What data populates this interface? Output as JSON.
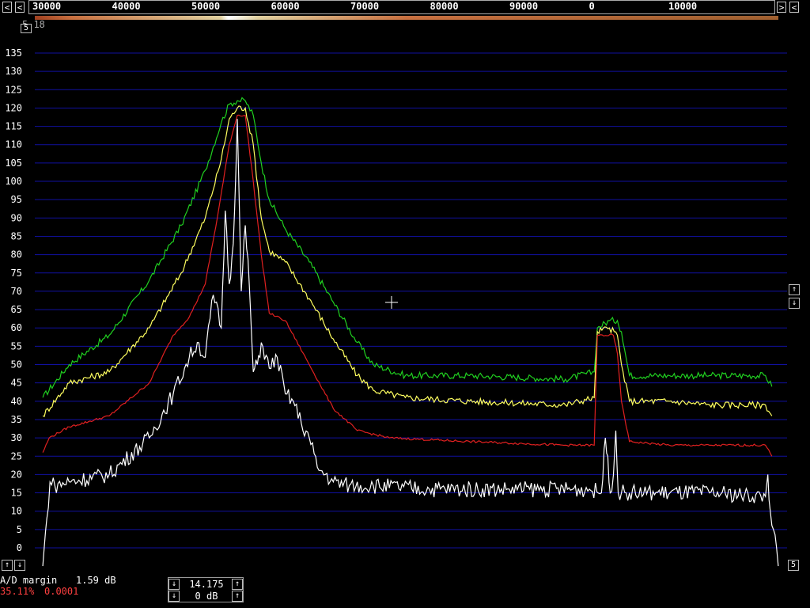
{
  "top_bar": {
    "left_arrow": "<",
    "right_arrow": ">",
    "right_arrow2": "<",
    "freq_labels": [
      "30000",
      "40000",
      "50000",
      "60000",
      "70000",
      "80000",
      "90000",
      "0",
      "10000"
    ]
  },
  "status": {
    "top_left_text": "5.18",
    "top_left_box": "5",
    "ad_margin_label": "A/D margin",
    "ad_margin_value": "1.59 dB",
    "percent": "35.11%",
    "ratio": "0.0001",
    "freq_value": "14.175",
    "gain_value": "0 dB",
    "bottom_right_box": "5",
    "up_arrow": "↑",
    "down_arrow": "↓"
  },
  "colors": {
    "grid": "#1010a0",
    "green": "#20d020",
    "yellow": "#ffff60",
    "red": "#e02020",
    "white": "#ffffff",
    "status_red": "#ff4040"
  },
  "chart_data": {
    "type": "line",
    "xlabel": "",
    "ylabel": "",
    "x_axis_ticks": [
      "30000",
      "40000",
      "50000",
      "60000",
      "70000",
      "80000",
      "90000",
      "0",
      "10000"
    ],
    "y_ticks": [
      135,
      130,
      125,
      120,
      115,
      110,
      105,
      100,
      95,
      90,
      85,
      80,
      75,
      70,
      65,
      60,
      55,
      50,
      45,
      40,
      35,
      30,
      25,
      20,
      15,
      10,
      5,
      0
    ],
    "ylim": [
      -5,
      137
    ],
    "xlim": [
      25700,
      119700
    ],
    "grid": true,
    "series": [
      {
        "color": "#20d020",
        "x": [
          26700,
          30000,
          35000,
          40000,
          44000,
          47000,
          49000,
          50000,
          51000,
          52000,
          53000,
          54000,
          55000,
          57000,
          60000,
          63000,
          66000,
          68000,
          72000,
          80000,
          92000,
          95600,
          96000,
          97500,
          98500,
          99000,
          100000,
          105000,
          110000,
          117000,
          117800
        ],
        "y": [
          41,
          50,
          58,
          73,
          88,
          103,
          116,
          121,
          122,
          122,
          118,
          105,
          95,
          87,
          78,
          67,
          56,
          50,
          47,
          47,
          46,
          48,
          60,
          62,
          62,
          59,
          47,
          47,
          47,
          47,
          44
        ]
      },
      {
        "color": "#ffff60",
        "x": [
          26700,
          30000,
          35000,
          40000,
          44000,
          47000,
          49000,
          50000,
          51000,
          52000,
          53000,
          54000,
          55000,
          57000,
          60000,
          63000,
          66000,
          68000,
          72000,
          80000,
          92000,
          95600,
          96000,
          97500,
          98500,
          99000,
          100000,
          105000,
          110000,
          117000,
          117800
        ],
        "y": [
          36,
          45,
          48,
          60,
          75,
          90,
          106,
          117,
          120,
          120,
          110,
          90,
          81,
          78,
          68,
          57,
          47,
          43,
          41,
          40,
          39,
          41,
          59,
          60,
          58,
          50,
          40,
          40,
          39,
          39,
          36
        ]
      },
      {
        "color": "#e02020",
        "x": [
          26700,
          27500,
          30000,
          35000,
          40000,
          43000,
          45000,
          47000,
          48500,
          50000,
          51000,
          52000,
          53000,
          54000,
          55000,
          57000,
          60000,
          63000,
          66000,
          70000,
          80000,
          92000,
          95600,
          96000,
          98000,
          98500,
          99000,
          100000,
          105000,
          110000,
          117000,
          117800
        ],
        "y": [
          26,
          30,
          33,
          36,
          45,
          58,
          63,
          72,
          90,
          110,
          118,
          118,
          100,
          80,
          64,
          62,
          50,
          38,
          32,
          30,
          29,
          28,
          28,
          58,
          58,
          53,
          40,
          29,
          28,
          28,
          28,
          25
        ]
      },
      {
        "color": "#ffffff",
        "x": [
          26700,
          27200,
          27600,
          28200,
          30000,
          35000,
          40000,
          43000,
          45000,
          46000,
          47000,
          48000,
          49000,
          49500,
          50000,
          50500,
          51000,
          51500,
          52000,
          52500,
          53000,
          53500,
          54000,
          55000,
          56000,
          57000,
          58000,
          59000,
          60000,
          61000,
          62000,
          63000,
          65000,
          68000,
          75000,
          85000,
          95000,
          96500,
          97000,
          97300,
          97600,
          98000,
          98300,
          98600,
          99000,
          100000,
          110000,
          117000,
          117300,
          117600,
          118000,
          118600
        ],
        "y": [
          -5,
          8,
          18,
          17,
          18,
          20,
          30,
          42,
          52,
          56,
          52,
          69,
          60,
          92,
          72,
          83,
          117,
          70,
          88,
          72,
          48,
          50,
          56,
          49,
          52,
          42,
          40,
          34,
          30,
          22,
          20,
          18,
          17,
          17,
          16,
          16,
          16,
          15,
          30,
          25,
          15,
          20,
          32,
          15,
          15,
          15,
          15,
          14,
          20,
          10,
          5,
          -5
        ]
      }
    ]
  }
}
